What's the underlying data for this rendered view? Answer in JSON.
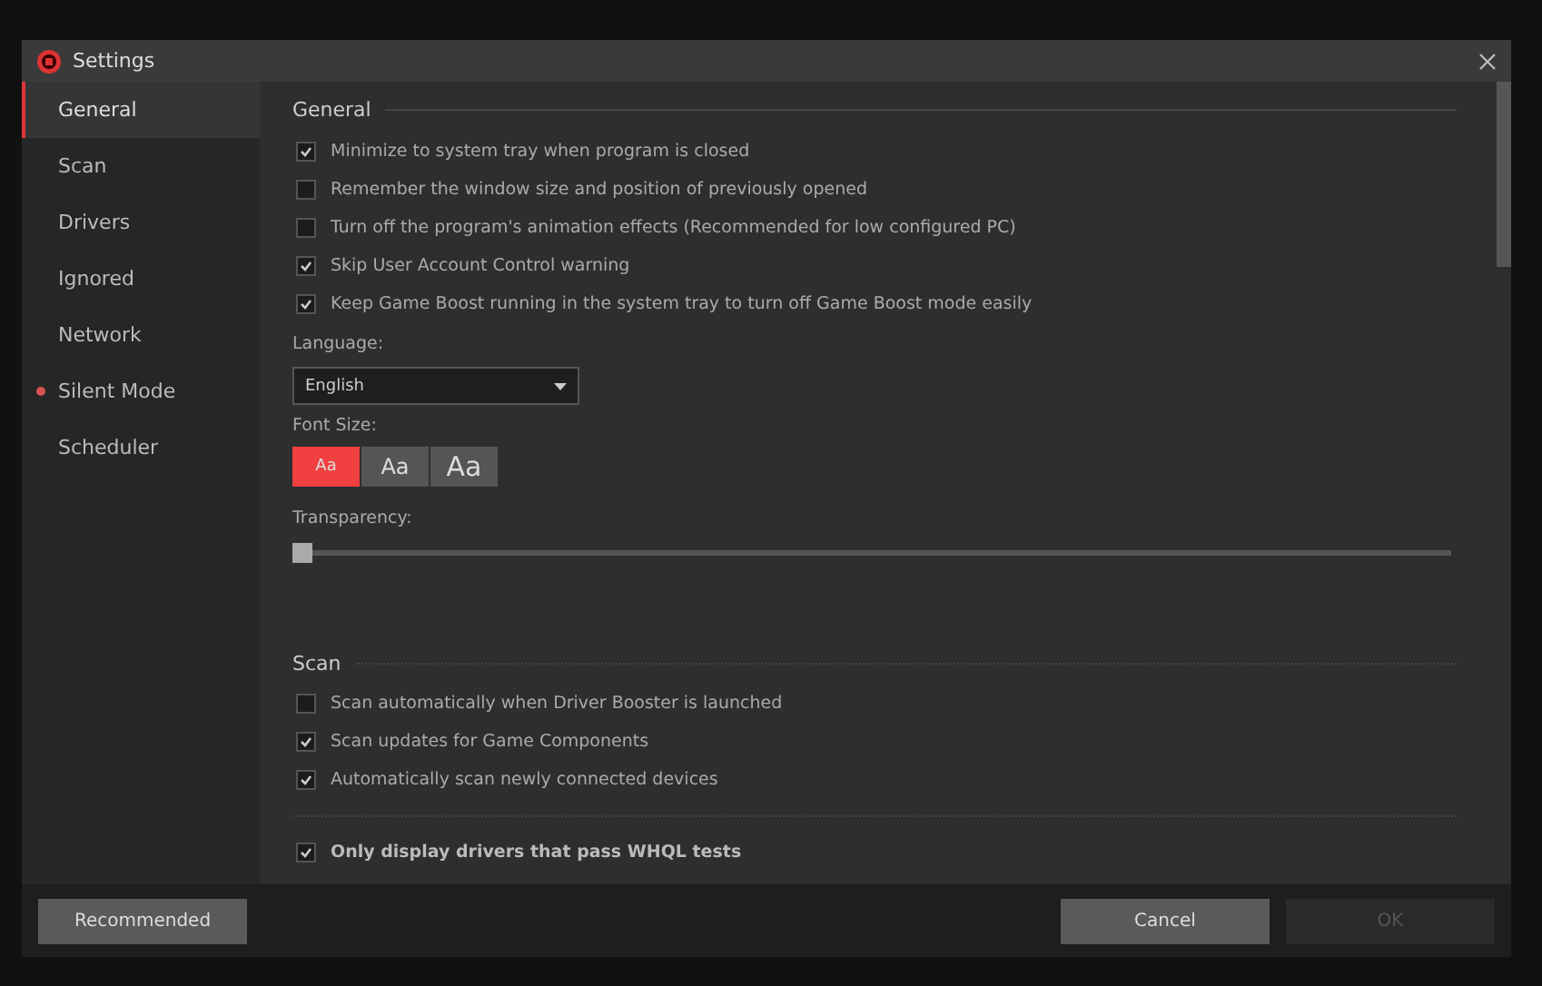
{
  "window": {
    "title": "Settings"
  },
  "sidebar": {
    "items": [
      {
        "label": "General",
        "selected": true,
        "dot": false
      },
      {
        "label": "Scan",
        "selected": false,
        "dot": false
      },
      {
        "label": "Drivers",
        "selected": false,
        "dot": false
      },
      {
        "label": "Ignored",
        "selected": false,
        "dot": false
      },
      {
        "label": "Network",
        "selected": false,
        "dot": false
      },
      {
        "label": "Silent Mode",
        "selected": false,
        "dot": true
      },
      {
        "label": "Scheduler",
        "selected": false,
        "dot": false
      }
    ]
  },
  "general": {
    "title": "General",
    "options": [
      {
        "label": "Minimize to system tray when program is closed",
        "checked": true
      },
      {
        "label": "Remember the window size and position of previously opened",
        "checked": false
      },
      {
        "label": "Turn off the program's animation effects (Recommended for low configured PC)",
        "checked": false
      },
      {
        "label": "Skip User Account Control warning",
        "checked": true
      },
      {
        "label": "Keep Game Boost running in the system tray to turn off Game Boost mode easily",
        "checked": true
      }
    ],
    "language": {
      "label": "Language:",
      "value": "English"
    },
    "font_size": {
      "label": "Font Size:",
      "options": [
        {
          "label": "Aa",
          "selected": true
        },
        {
          "label": "Aa",
          "selected": false
        },
        {
          "label": "Aa",
          "selected": false
        }
      ]
    },
    "transparency": {
      "label": "Transparency:",
      "level": 0
    }
  },
  "scan": {
    "title": "Scan",
    "options": [
      {
        "label": "Scan automatically when Driver Booster is launched",
        "checked": false
      },
      {
        "label": "Scan updates for Game Components",
        "checked": true
      },
      {
        "label": "Automatically scan newly connected devices",
        "checked": true
      }
    ],
    "whql": {
      "label": "Only display drivers that pass WHQL tests",
      "checked": true
    }
  },
  "buttons": {
    "recommended": {
      "label": "Recommended",
      "disabled": false
    },
    "cancel": {
      "label": "Cancel",
      "disabled": false
    },
    "ok": {
      "label": "OK",
      "disabled": true
    }
  }
}
